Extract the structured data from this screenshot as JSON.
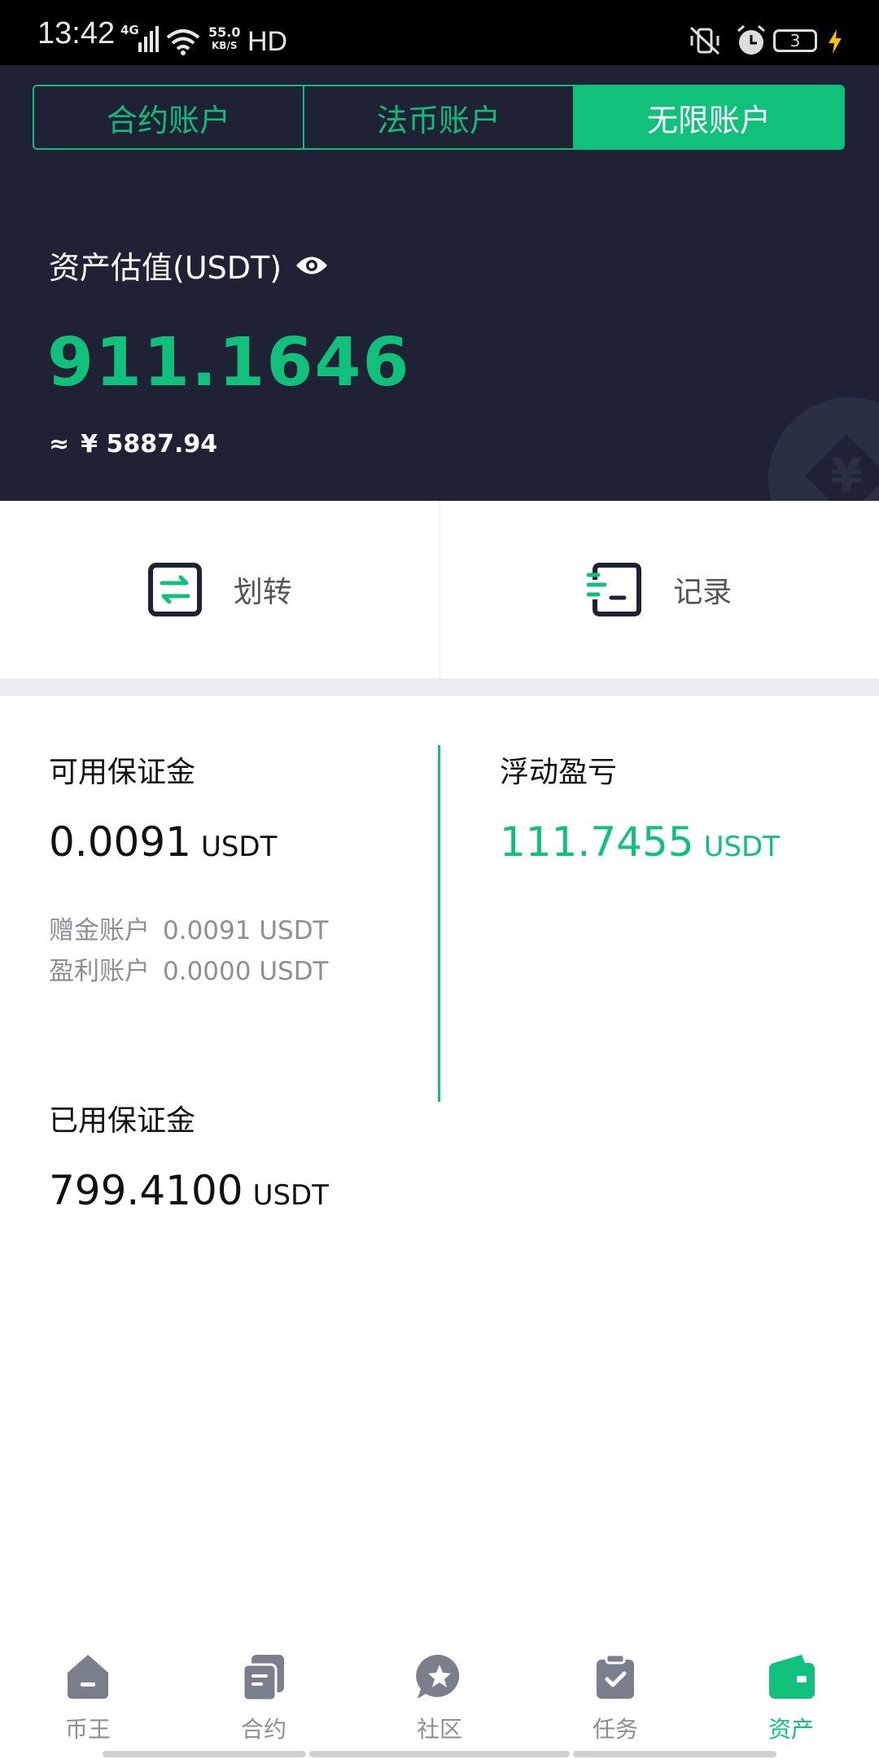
{
  "status_bar": {
    "time": "13:42",
    "network": "4G",
    "speed_value": "55.0",
    "speed_unit": "KB/S",
    "hd": "HD",
    "battery": "3"
  },
  "tabs": [
    {
      "label": "合约账户",
      "active": false
    },
    {
      "label": "法币账户",
      "active": false
    },
    {
      "label": "无限账户",
      "active": true
    }
  ],
  "asset": {
    "label": "资产估值(USDT)",
    "value": "911.1646",
    "approx_symbol": "≈",
    "cny": "¥ 5887.94"
  },
  "actions": {
    "transfer": "划转",
    "records": "记录"
  },
  "margin": {
    "available_label": "可用保证金",
    "available_value": "0.0091",
    "unit": "USDT",
    "bonus_label": "赠金账户",
    "bonus_value": "0.0091  USDT",
    "profit_label": "盈利账户",
    "profit_value": "0.0000  USDT",
    "used_label": "已用保证金",
    "used_value": "799.4100",
    "pnl_label": "浮动盈亏",
    "pnl_value": "111.7455"
  },
  "bottom_nav": [
    {
      "label": "币王",
      "icon": "home-icon"
    },
    {
      "label": "合约",
      "icon": "contract-icon"
    },
    {
      "label": "社区",
      "icon": "community-icon"
    },
    {
      "label": "任务",
      "icon": "task-icon"
    },
    {
      "label": "资产",
      "icon": "wallet-icon",
      "active": true
    }
  ],
  "colors": {
    "accent": "#10c07b",
    "header_bg": "#1f2235"
  }
}
